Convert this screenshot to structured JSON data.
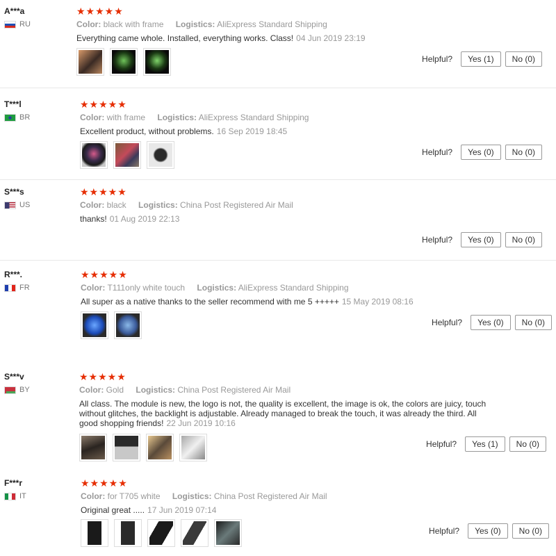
{
  "helpful_label": "Helpful?",
  "reviews": [
    {
      "user": "A***a",
      "country": "RU",
      "stars": "★★★★★",
      "color_label": "Color:",
      "color": "black with frame",
      "logistics_label": "Logistics:",
      "logistics": "AliExpress Standard Shipping",
      "text": "Everything came whole. Installed, everything works. Class!",
      "date": "04 Jun 2019 23:19",
      "yes": "Yes (1)",
      "no": "No (0)"
    },
    {
      "user": "T***l",
      "country": "BR",
      "stars": "★★★★★",
      "color_label": "Color:",
      "color": "with frame",
      "logistics_label": "Logistics:",
      "logistics": "AliExpress Standard Shipping",
      "text": "Excellent product, without problems.",
      "date": "16 Sep 2019 18:45",
      "yes": "Yes (0)",
      "no": "No (0)"
    },
    {
      "user": "S***s",
      "country": "US",
      "stars": "★★★★★",
      "color_label": "Color:",
      "color": "black",
      "logistics_label": "Logistics:",
      "logistics": "China Post Registered Air Mail",
      "text": "thanks!",
      "date": "01 Aug 2019 22:13",
      "yes": "Yes (0)",
      "no": "No (0)"
    },
    {
      "user": "R***.",
      "country": "FR",
      "stars": "★★★★★",
      "color_label": "Color:",
      "color": "T111only white touch",
      "logistics_label": "Logistics:",
      "logistics": "AliExpress Standard Shipping",
      "text": "All super as a native thanks to the seller recommend with me 5 +++++",
      "date": "15 May 2019 08:16",
      "yes": "Yes (0)",
      "no": "No (0)"
    },
    {
      "user": "S***v",
      "country": "BY",
      "stars": "★★★★★",
      "color_label": "Color:",
      "color": "Gold",
      "logistics_label": "Logistics:",
      "logistics": "China Post Registered Air Mail",
      "text": "All class. The module is new, the logo is not, the quality is excellent, the image is ok, the colors are juicy, touch without glitches, the backlight is adjustable. Already managed to break the touch, it was already the third. All good shopping friends!",
      "date": "22 Jun 2019 10:16",
      "yes": "Yes (1)",
      "no": "No (0)"
    },
    {
      "user": "F***r",
      "country": "IT",
      "stars": "★★★★★",
      "color_label": "Color:",
      "color": "for T705 white",
      "logistics_label": "Logistics:",
      "logistics": "China Post Registered Air Mail",
      "text": "Original great .....",
      "date": "17 Jun 2019 07:14",
      "yes": "Yes (0)",
      "no": "No (0)"
    }
  ],
  "colors": {
    "star": "#e62e04",
    "meta": "#999999",
    "divider": "#e8e8e8"
  }
}
